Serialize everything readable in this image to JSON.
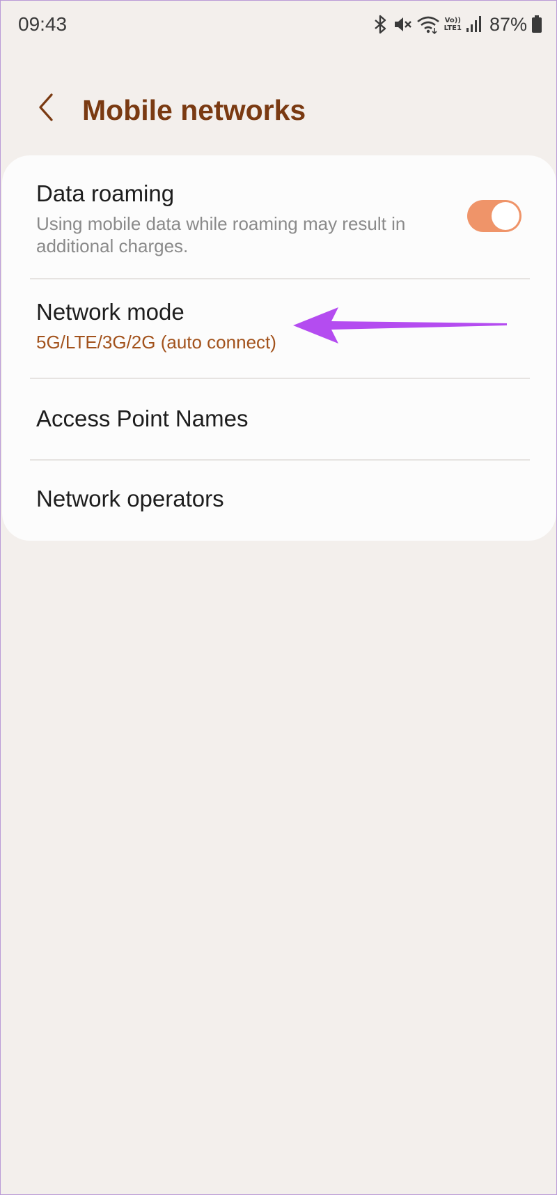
{
  "status_bar": {
    "time": "09:43",
    "battery_percent": "87%",
    "lte_badge_top": "Vo))",
    "lte_badge_bottom": "LTE1",
    "icons": [
      "bluetooth-icon",
      "mute-icon",
      "wifi-icon",
      "volte-icon",
      "signal-icon",
      "battery-icon"
    ]
  },
  "header": {
    "title": "Mobile networks",
    "back_icon": "chevron-left-icon"
  },
  "settings": {
    "data_roaming": {
      "title": "Data roaming",
      "subtitle": "Using mobile data while roaming may result in additional charges.",
      "enabled": true
    },
    "network_mode": {
      "title": "Network mode",
      "value": "5G/LTE/3G/2G (auto connect)"
    },
    "access_point_names": {
      "title": "Access Point Names"
    },
    "network_operators": {
      "title": "Network operators"
    }
  },
  "colors": {
    "background": "#f3efec",
    "card": "#fcfcfc",
    "title_accent": "#7a3a12",
    "value_accent": "#a2521c",
    "toggle_on": "#ef9469",
    "annotation_arrow": "#b44cf0"
  },
  "annotation": {
    "icon": "arrow-left-icon",
    "points_to": "network-mode-row"
  }
}
